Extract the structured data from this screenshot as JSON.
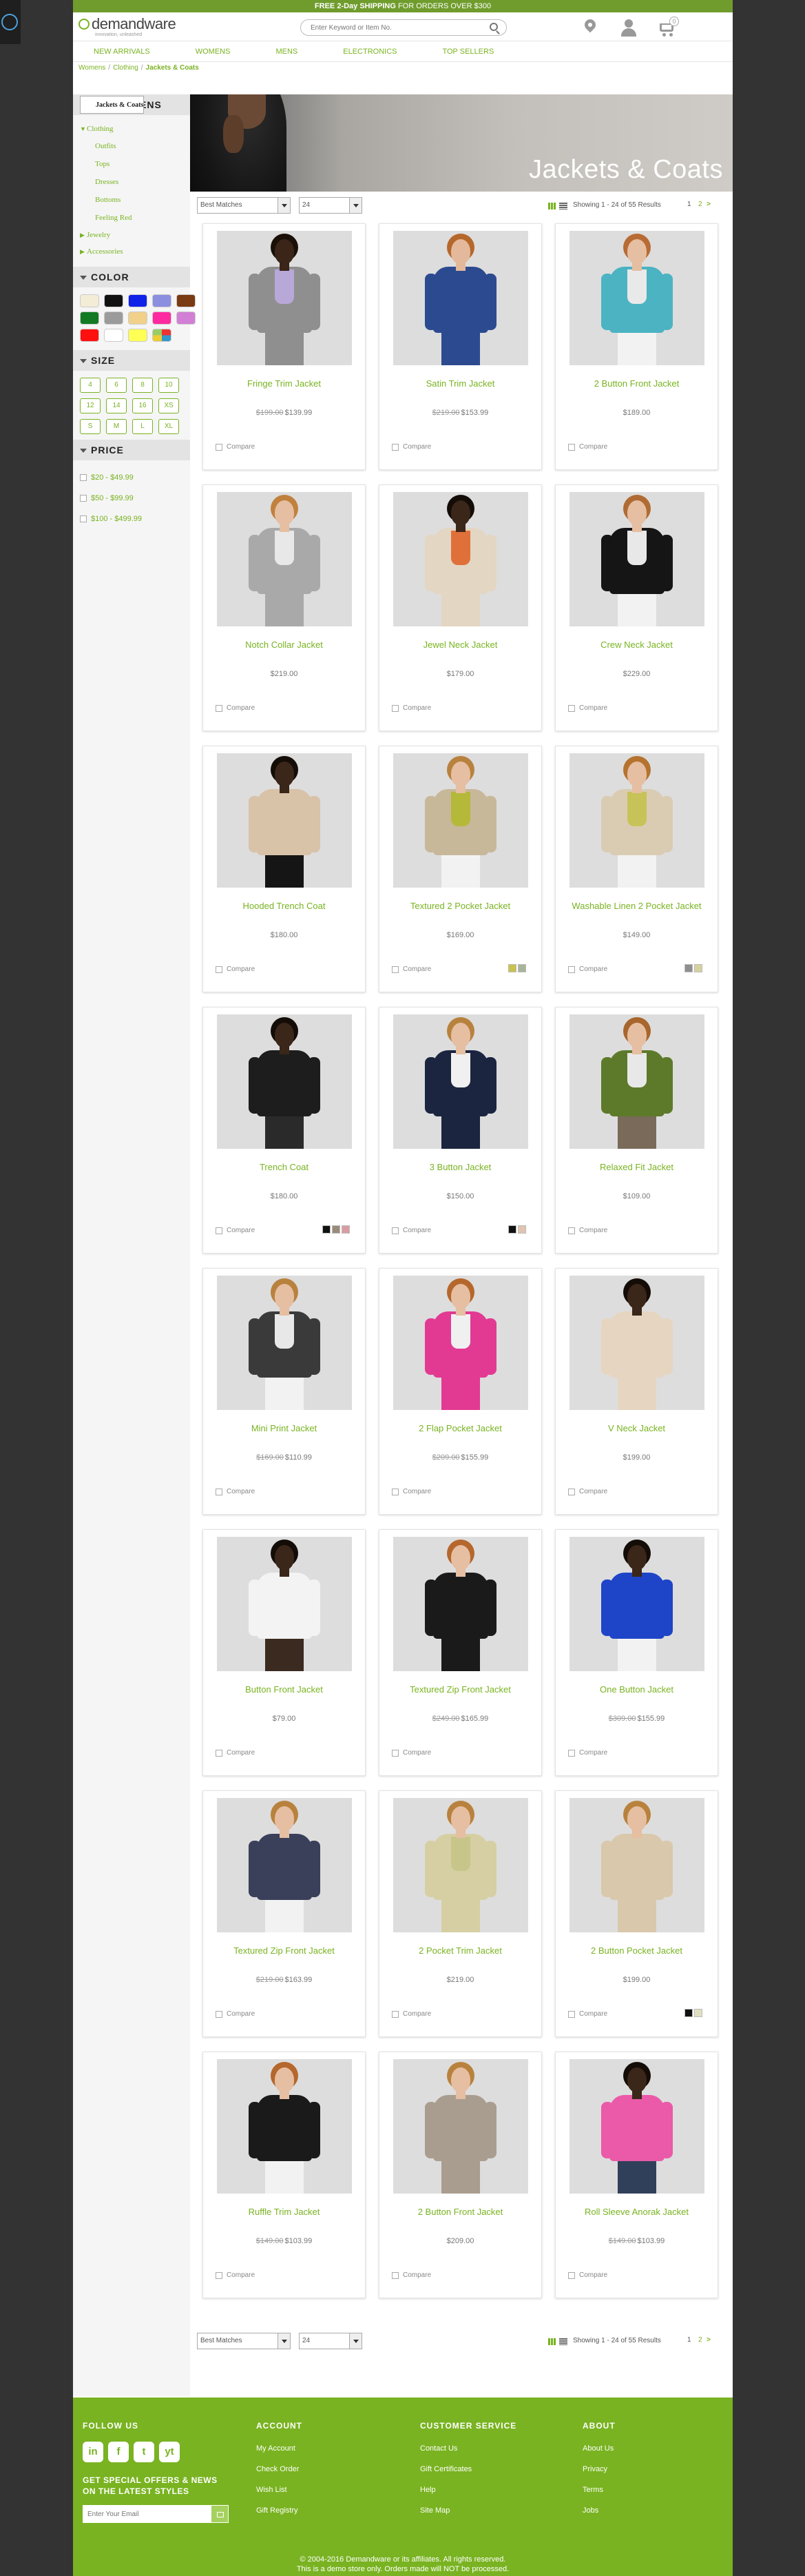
{
  "promo": {
    "bold": "FREE 2-Day SHIPPING",
    "rest": " FOR ORDERS OVER $300"
  },
  "header": {
    "logo": "demandware",
    "tagline": "innovation, unleashed",
    "search_placeholder": "Enter Keyword or Item No.",
    "cart_count": "0"
  },
  "nav": [
    "NEW ARRIVALS",
    "WOMENS",
    "MENS",
    "ELECTRONICS",
    "TOP SELLERS"
  ],
  "breadcrumb": [
    "Womens",
    "Clothing",
    "Jackets & Coats"
  ],
  "sidebar": {
    "heading": "SHOP WOMENS",
    "categories": [
      {
        "label": "Clothing",
        "children": [
          "Outfits",
          "Tops",
          "Dresses",
          "Bottoms",
          "Jackets & Coats",
          "Feeling Red"
        ],
        "selected": "Jackets & Coats"
      },
      {
        "label": "Jewelry"
      },
      {
        "label": "Accessories"
      }
    ],
    "color_title": "COLOR",
    "colors": [
      "#f3ecd6",
      "#111111",
      "#1021e8",
      "#8c8ee0",
      "#7a3a12",
      "#117a22",
      "#9b9b9b",
      "#f1d08a",
      "#ff2aa0",
      "#d27fd6",
      "#ff1010",
      "#ffffff",
      "#ffff55",
      "misc"
    ],
    "size_title": "SIZE",
    "sizes": [
      "4",
      "6",
      "8",
      "10",
      "12",
      "14",
      "16",
      "XS",
      "S",
      "M",
      "L",
      "XL"
    ],
    "price_title": "PRICE",
    "prices": [
      "$20 - $49.99",
      "$50 - $99.99",
      "$100 - $499.99"
    ]
  },
  "banner_title": "Jackets & Coats",
  "toolbar": {
    "sort": "Best Matches",
    "per_page": "24",
    "results": "Showing 1 - 24 of 55 Results",
    "page_current": "1",
    "page_next": "2",
    "next_arrow": ">"
  },
  "compare_label": "Compare",
  "products": [
    {
      "name": "Fringe Trim Jacket",
      "old": "$199.00",
      "price": "$139.99",
      "skin": "#3a2518",
      "hair": "#1a1008",
      "jacket": "#8f8f8f",
      "top": "#b8a8d8",
      "legs": "#8f8f8f",
      "vars": []
    },
    {
      "name": "Satin Trim Jacket",
      "old": "$219.00",
      "price": "$153.99",
      "skin": "#e4b89a",
      "hair": "#b5672c",
      "jacket": "#2c4a8f",
      "top": "#2c4a8f",
      "legs": "#2c4a8f",
      "vars": []
    },
    {
      "name": "2 Button Front Jacket",
      "old": "",
      "price": "$189.00",
      "skin": "#e6bea2",
      "hair": "#b86b34",
      "jacket": "#4bb3c2",
      "top": "#e9e9e9",
      "legs": "#f2f2f2",
      "vars": []
    },
    {
      "name": "Notch Collar Jacket",
      "old": "",
      "price": "$219.00",
      "skin": "#e6bea2",
      "hair": "#c0813e",
      "jacket": "#a9a9a9",
      "top": "#e8e8e8",
      "legs": "#a9a9a9",
      "vars": []
    },
    {
      "name": "Jewel Neck Jacket",
      "old": "",
      "price": "$179.00",
      "skin": "#3b261a",
      "hair": "#140c07",
      "jacket": "#e3d6c2",
      "top": "#e0703a",
      "legs": "#e3d6c2",
      "vars": []
    },
    {
      "name": "Crew Neck Jacket",
      "old": "",
      "price": "$229.00",
      "skin": "#e6bea2",
      "hair": "#b06b34",
      "jacket": "#151515",
      "top": "#e8e8e8",
      "legs": "#f2f2f2",
      "vars": []
    },
    {
      "name": "Hooded Trench Coat",
      "old": "",
      "price": "$180.00",
      "skin": "#3b261a",
      "hair": "#140c07",
      "jacket": "#d8c2a8",
      "top": "#d8c2a8",
      "legs": "#151515",
      "vars": []
    },
    {
      "name": "Textured 2 Pocket Jacket",
      "old": "",
      "price": "$169.00",
      "skin": "#e6bea2",
      "hair": "#b8823e",
      "jacket": "#c8b89a",
      "top": "#b4b93a",
      "legs": "#f2f2f2",
      "vars": [
        "#c9c34d",
        "#a8b49a"
      ]
    },
    {
      "name": "Washable Linen 2 Pocket Jacket",
      "old": "",
      "price": "$149.00",
      "skin": "#e6bea2",
      "hair": "#b5732f",
      "jacket": "#d9ccb3",
      "top": "#c7c358",
      "legs": "#f2f2f2",
      "vars": [
        "#8f8f8f",
        "#d6d2a0"
      ]
    },
    {
      "name": "Trench Coat",
      "old": "",
      "price": "$180.00",
      "skin": "#3b261a",
      "hair": "#140c07",
      "jacket": "#1d1d1d",
      "top": "#1d1d1d",
      "legs": "#2a2a2a",
      "vars": [
        "#111111",
        "#9a8a7a",
        "#d99ca3"
      ]
    },
    {
      "name": "3 Button Jacket",
      "old": "",
      "price": "$150.00",
      "skin": "#e6bea2",
      "hair": "#b8823e",
      "jacket": "#1b2540",
      "top": "#f0f0f0",
      "legs": "#1b2540",
      "vars": [
        "#111111",
        "#e0c4b0"
      ]
    },
    {
      "name": "Relaxed Fit Jacket",
      "old": "",
      "price": "$109.00",
      "skin": "#e6bea2",
      "hair": "#a8652c",
      "jacket": "#5d7a2a",
      "top": "#e8e8e8",
      "legs": "#7a6a5a",
      "vars": []
    },
    {
      "name": "Mini Print Jacket",
      "old": "$169.00",
      "price": "$110.99",
      "skin": "#e6bea2",
      "hair": "#b8823e",
      "jacket": "#3a3a3a",
      "top": "#e8e8e8",
      "legs": "#f2f2f2",
      "vars": []
    },
    {
      "name": "2 Flap Pocket Jacket",
      "old": "$209.00",
      "price": "$155.99",
      "skin": "#e6bea2",
      "hair": "#b5672c",
      "jacket": "#e23a93",
      "top": "#f0f0f0",
      "legs": "#e23a93",
      "vars": []
    },
    {
      "name": "V Neck Jacket",
      "old": "",
      "price": "$199.00",
      "skin": "#3b261a",
      "hair": "#140c07",
      "jacket": "#e6d6c1",
      "top": "#e6d6c1",
      "legs": "#e6d6c1",
      "vars": []
    },
    {
      "name": "Button Front Jacket",
      "old": "",
      "price": "$79.00",
      "skin": "#3b261a",
      "hair": "#140c07",
      "jacket": "#f3f3f3",
      "top": "#f3f3f3",
      "legs": "#3a2a20",
      "vars": []
    },
    {
      "name": "Textured Zip Front Jacket",
      "old": "$249.00",
      "price": "$165.99",
      "skin": "#e6bea2",
      "hair": "#b5672c",
      "jacket": "#1a1a1a",
      "top": "#1a1a1a",
      "legs": "#1a1a1a",
      "vars": []
    },
    {
      "name": "One Button Jacket",
      "old": "$309.00",
      "price": "$155.99",
      "skin": "#3b261a",
      "hair": "#140c07",
      "jacket": "#1e45c8",
      "top": "#1e45c8",
      "legs": "#f2f2f2",
      "vars": []
    },
    {
      "name": "Textured Zip Front Jacket",
      "old": "$219.00",
      "price": "$163.99",
      "skin": "#e6bea2",
      "hair": "#b8823e",
      "jacket": "#3a3f5a",
      "top": "#3a3f5a",
      "legs": "#f2f2f2",
      "vars": []
    },
    {
      "name": "2 Pocket Trim Jacket",
      "old": "",
      "price": "$219.00",
      "skin": "#e6bea2",
      "hair": "#b8823e",
      "jacket": "#d6cfa3",
      "top": "#c8c58a",
      "legs": "#d6cfa3",
      "vars": []
    },
    {
      "name": "2 Button Pocket Jacket",
      "old": "",
      "price": "$199.00",
      "skin": "#e6bea2",
      "hair": "#b8823e",
      "jacket": "#d9c8ab",
      "top": "#d9c8ab",
      "legs": "#d9c8ab",
      "vars": [
        "#111111",
        "#e0e0c0"
      ]
    },
    {
      "name": "Ruffle Trim Jacket",
      "old": "$149.00",
      "price": "$103.99",
      "skin": "#e6bea2",
      "hair": "#b5672c",
      "jacket": "#1a1a1a",
      "top": "#1a1a1a",
      "legs": "#f2f2f2",
      "vars": []
    },
    {
      "name": "2 Button Front Jacket",
      "old": "",
      "price": "$209.00",
      "skin": "#e6bea2",
      "hair": "#b8823e",
      "jacket": "#a99d90",
      "top": "#a99d90",
      "legs": "#a99d90",
      "vars": []
    },
    {
      "name": "Roll Sleeve Anorak Jacket",
      "old": "$149.00",
      "price": "$103.99",
      "skin": "#3b261a",
      "hair": "#140c07",
      "jacket": "#ea5aa8",
      "top": "#ea5aa8",
      "legs": "#30405a",
      "vars": []
    }
  ],
  "footer": {
    "follow_title": "FOLLOW US",
    "social": [
      "in",
      "f",
      "t",
      "yt"
    ],
    "signup": "GET SPECIAL OFFERS & NEWS ON THE LATEST STYLES",
    "email_placeholder": "Enter Your Email",
    "account_title": "ACCOUNT",
    "account_links": [
      "My Account",
      "Check Order",
      "Wish List",
      "Gift Registry"
    ],
    "service_title": "CUSTOMER SERVICE",
    "service_links": [
      "Contact Us",
      "Gift Certificates",
      "Help",
      "Site Map"
    ],
    "about_title": "ABOUT",
    "about_links": [
      "About Us",
      "Privacy",
      "Terms",
      "Jobs"
    ],
    "copyright1": "© 2004-2016 Demandware or its affiliates. All rights reserved.",
    "copyright2": "This is a demo store only. Orders made will NOT be processed."
  }
}
